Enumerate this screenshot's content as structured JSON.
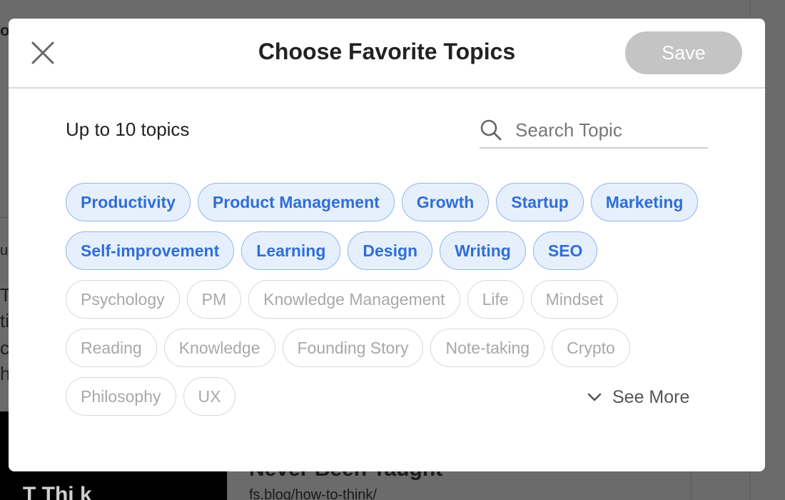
{
  "background": {
    "fragments_left": [
      "o",
      "u",
      "T",
      "ti",
      "ca",
      "h"
    ],
    "article_title": "Never Been Taught",
    "article_url": "fs.blog/how-to-think/",
    "dark_block_text": "T Thi k"
  },
  "modal": {
    "title": "Choose Favorite Topics",
    "save_label": "Save",
    "limit_text": "Up to 10 topics",
    "search": {
      "placeholder": "Search Topic",
      "value": ""
    },
    "see_more_label": "See More",
    "topic_rows": [
      [
        {
          "label": "Productivity",
          "selected": true
        },
        {
          "label": "Product Management",
          "selected": true
        },
        {
          "label": "Growth",
          "selected": true
        },
        {
          "label": "Startup",
          "selected": true
        },
        {
          "label": "Marketing",
          "selected": true
        }
      ],
      [
        {
          "label": "Self-improvement",
          "selected": true
        },
        {
          "label": "Learning",
          "selected": true
        },
        {
          "label": "Design",
          "selected": true
        },
        {
          "label": "Writing",
          "selected": true
        },
        {
          "label": "SEO",
          "selected": true
        }
      ],
      [
        {
          "label": "Psychology",
          "selected": false
        },
        {
          "label": "PM",
          "selected": false
        },
        {
          "label": "Knowledge Management",
          "selected": false
        },
        {
          "label": "Life",
          "selected": false
        },
        {
          "label": "Mindset",
          "selected": false
        }
      ],
      [
        {
          "label": "Reading",
          "selected": false
        },
        {
          "label": "Knowledge",
          "selected": false
        },
        {
          "label": "Founding Story",
          "selected": false
        },
        {
          "label": "Note-taking",
          "selected": false
        },
        {
          "label": "Crypto",
          "selected": false
        }
      ],
      [
        {
          "label": "Philosophy",
          "selected": false
        },
        {
          "label": "UX",
          "selected": false
        }
      ]
    ]
  },
  "colors": {
    "overlay": "#6b6b6b",
    "selected_bg": "#e6f0fd",
    "selected_text": "#2f6ed8",
    "selected_border": "#8fb4ee",
    "unselected_text": "#a8a8a8",
    "save_disabled": "#c4c4c4"
  },
  "icons": {
    "close": "close-icon",
    "search": "search-icon",
    "see_more": "chevron-down-icon"
  }
}
